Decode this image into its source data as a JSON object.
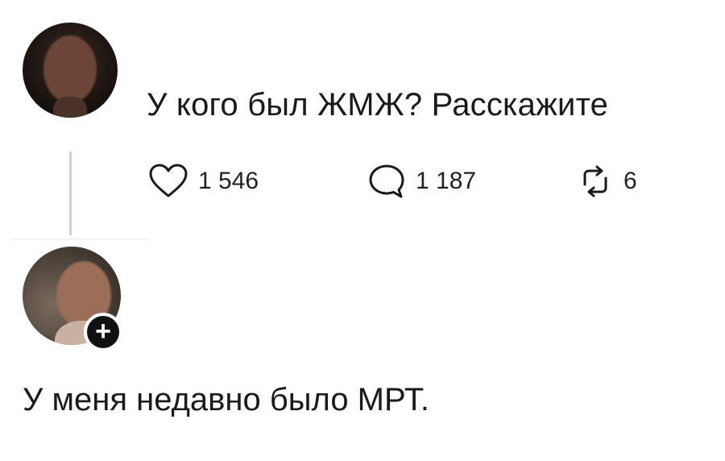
{
  "post": {
    "text": "У кого был ЖМЖ? Расскажите",
    "likes": "1 546",
    "replies": "1 187",
    "reposts": "6"
  },
  "reply": {
    "text": "У меня недавно было МРТ.",
    "badge": "+"
  },
  "icons": {
    "like": "heart-icon",
    "reply": "comment-bubble-icon",
    "repost": "repost-icon"
  }
}
